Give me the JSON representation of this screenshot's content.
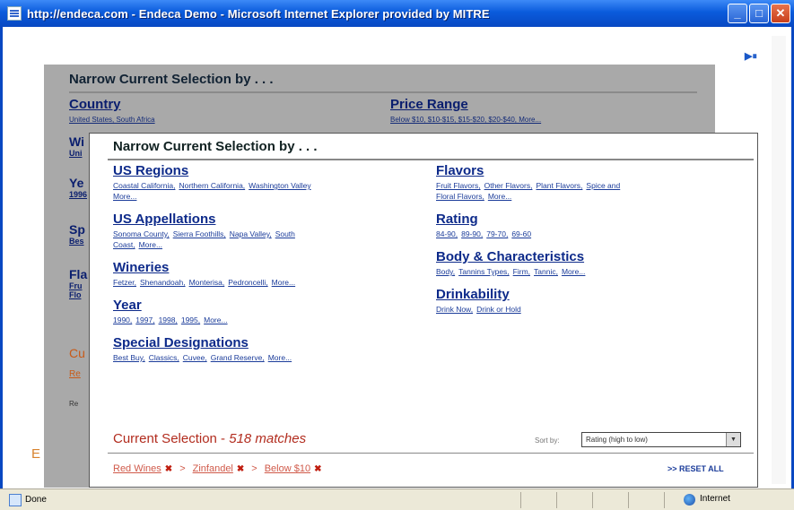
{
  "window": {
    "title": "http://endeca.com - Endeca Demo - Microsoft Internet Explorer provided by MITRE",
    "buttons": {
      "minimize": "_",
      "maximize": "□",
      "close": "✕"
    }
  },
  "media_control": "▶⏸",
  "background_panel": {
    "header": "Narrow Current Selection by . . .",
    "country": {
      "title": "Country",
      "links": "United States, South Africa"
    },
    "price_range": {
      "title": "Price Range",
      "links": "Below $10, $10-$15, $15-$20, $20-$40, More..."
    },
    "stubs": [
      "Wi",
      "Ye",
      "Sp",
      "Fla",
      "Cu",
      "Re"
    ],
    "stub_subs": [
      "Uni",
      "Uni",
      "1996",
      "Bes",
      "Fru",
      "Flo"
    ],
    "stub_cu_sub": "Re",
    "orange_e": "E"
  },
  "panel": {
    "header": "Narrow Current Selection by . . .",
    "left_column": [
      {
        "title": "US Regions",
        "links": [
          "Coastal California,",
          "Northern California,",
          "Washington Valley",
          "More..."
        ]
      },
      {
        "title": "US Appellations",
        "links": [
          "Sonoma County,",
          "Sierra Foothills,",
          "Napa Valley,",
          "South",
          "Coast,",
          "More..."
        ]
      },
      {
        "title": "Wineries",
        "links": [
          "Fetzer,",
          "Shenandoah,",
          "Monterisa,",
          "Pedroncelli,",
          "More..."
        ]
      },
      {
        "title": "Year",
        "links": [
          "1990,",
          "1997,",
          "1998,",
          "1995,",
          "More..."
        ]
      },
      {
        "title": "Special Designations",
        "links": [
          "Best Buy,",
          "Classics,",
          "Cuvee,",
          "Grand Reserve,",
          "More..."
        ]
      }
    ],
    "right_column": [
      {
        "title": "Flavors",
        "links": [
          "Fruit Flavors,",
          "Other Flavors,",
          "Plant Flavors,",
          "Spice and",
          "Floral Flavors,",
          "More..."
        ]
      },
      {
        "title": "Rating",
        "links": [
          "84-90,",
          "89-90,",
          "79-70,",
          "69-60"
        ]
      },
      {
        "title": "Body & Characteristics",
        "links": [
          "Body,",
          "Tannins Types,",
          "Firm,",
          "Tannic,",
          "More..."
        ]
      },
      {
        "title": "Drinkability",
        "links": [
          "Drink Now,",
          "Drink or Hold"
        ]
      }
    ],
    "current_selection": {
      "label": "Current Selection - ",
      "matches": "518 matches"
    },
    "sort": {
      "label": "Sort by:",
      "value": "Rating (high to low)"
    },
    "crumbs": [
      {
        "label": "Red Wines"
      },
      {
        "label": "Zinfandel"
      },
      {
        "label": "Below $10"
      }
    ],
    "crumb_separator": ">",
    "reset_all": ">> RESET ALL"
  },
  "statusbar": {
    "status": "Done",
    "zone": "Internet"
  }
}
